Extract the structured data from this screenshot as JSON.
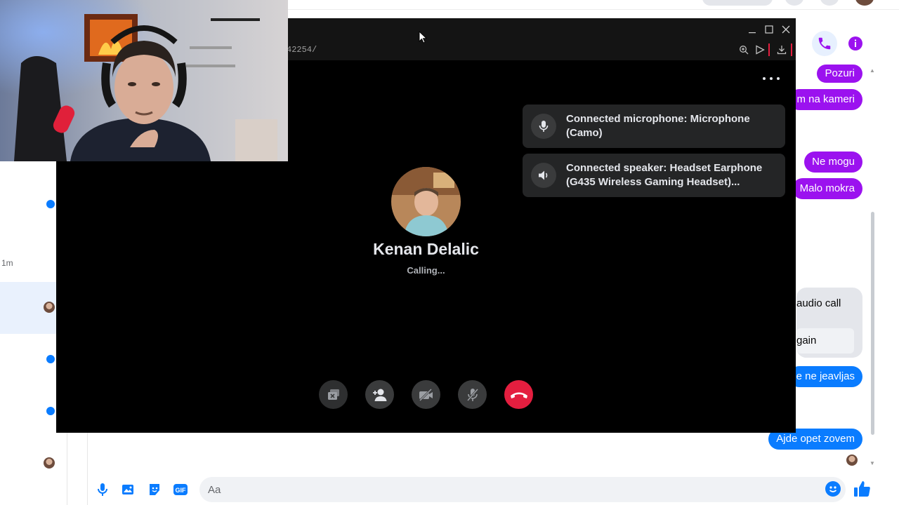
{
  "chat_list": {
    "time_label": "1m"
  },
  "conversation": {
    "messages": [
      {
        "text": "Pozuri",
        "style": "purple"
      },
      {
        "text": "m na kameri",
        "style": "purple"
      },
      {
        "text": "Ne mogu",
        "style": "purple"
      },
      {
        "text": "Malo mokra",
        "style": "purple"
      },
      {
        "text": "e ne jeavljas",
        "style": "blue"
      },
      {
        "text": "Ajde opet zovem",
        "style": "blue"
      }
    ],
    "system_message": {
      "text": "audio call",
      "button_label": "gain"
    }
  },
  "composer": {
    "placeholder": "Aa"
  },
  "call_window": {
    "url_fragment": "42254/",
    "notifications": [
      {
        "icon": "microphone-icon",
        "text": "Connected microphone: Microphone (Camo)"
      },
      {
        "icon": "speaker-icon",
        "text": "Connected speaker: Headset Earphone (G435 Wireless Gaming Headset)..."
      }
    ],
    "callee_name": "Kenan Delalic",
    "status": "Calling...",
    "controls": [
      "screen-share-icon",
      "add-person-icon",
      "video-off-icon",
      "mic-off-icon",
      "end-call-icon"
    ]
  },
  "colors": {
    "messenger_purple": "#9b12ef",
    "messenger_blue": "#0a7cff",
    "end_call_red": "#e41e3f",
    "call_background": "#000000",
    "toast_background": "#242526"
  }
}
